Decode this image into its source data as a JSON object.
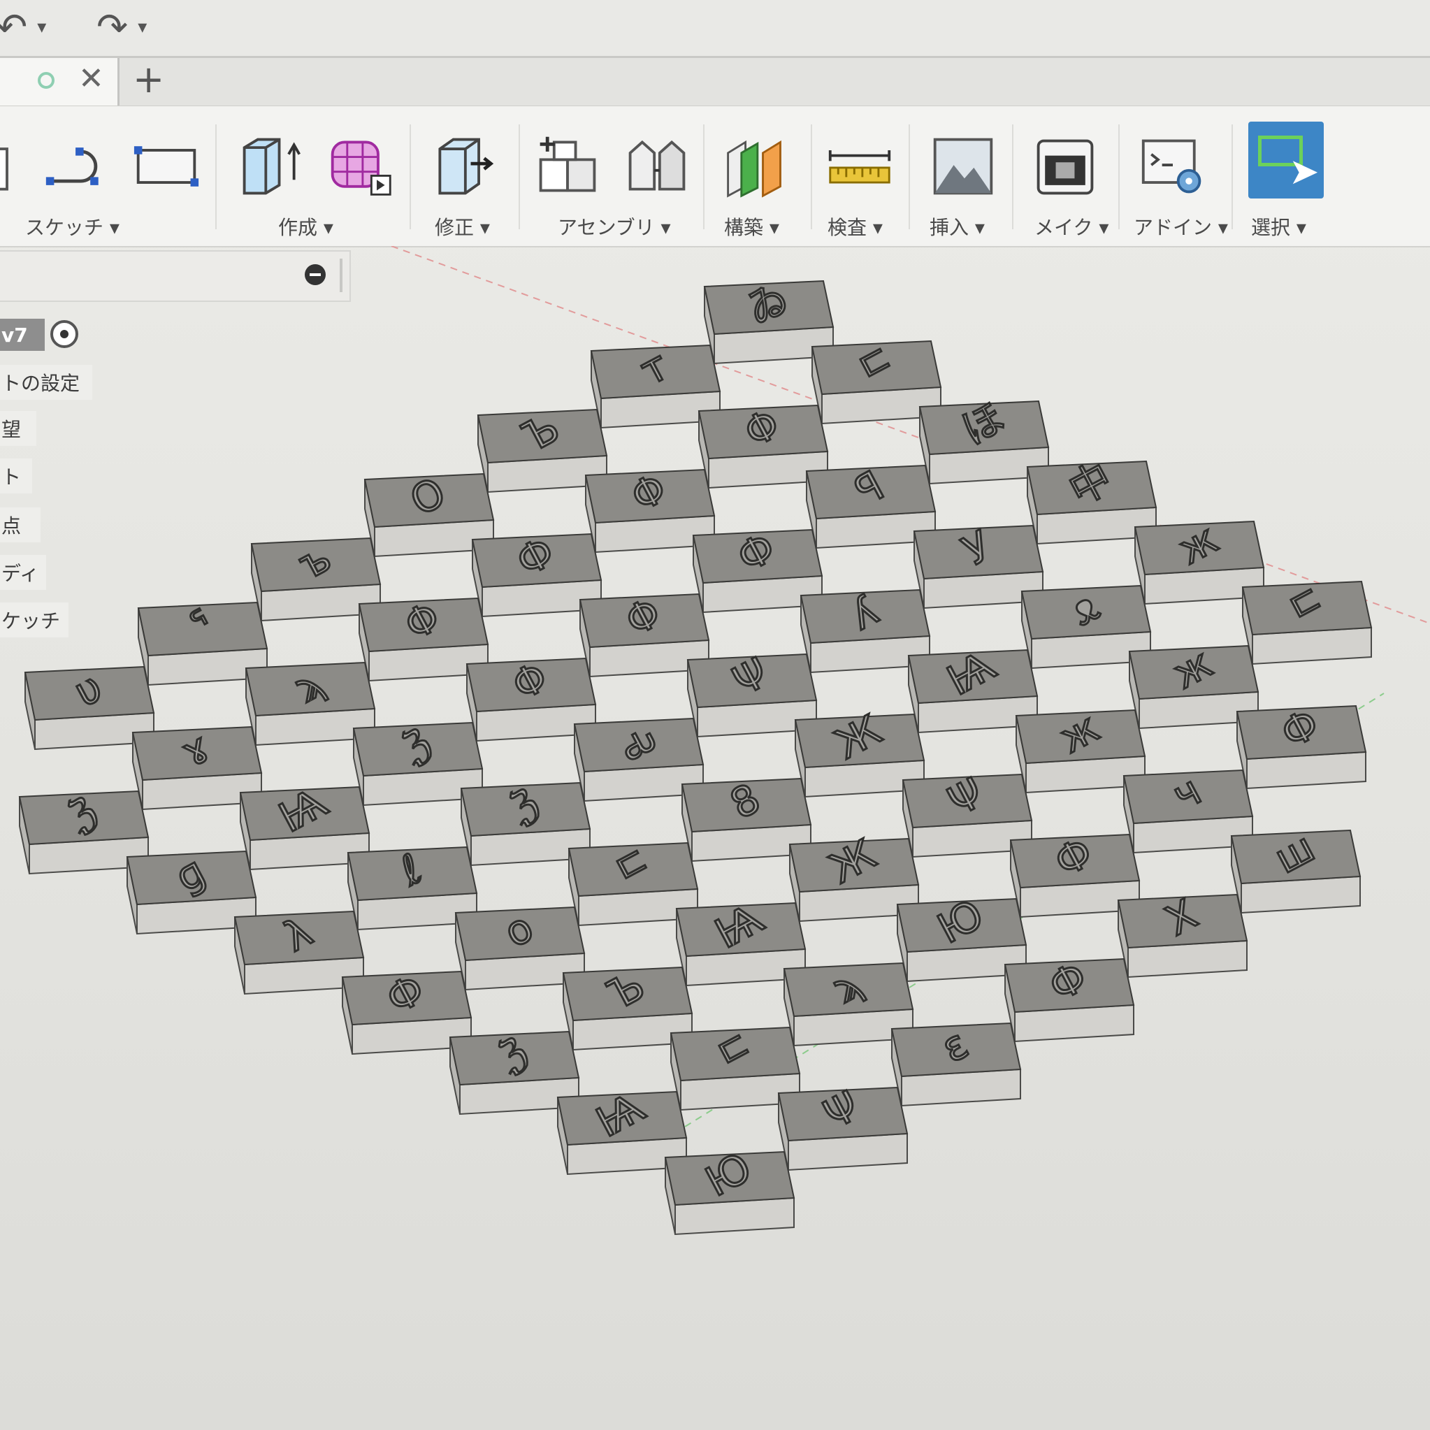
{
  "quick_access": {
    "undo_icon": "undo-arrow-icon",
    "redo_icon": "redo-arrow-icon",
    "dropdown_glyph": "▾"
  },
  "tabs": {
    "add_glyph": "+",
    "close_glyph": "✕"
  },
  "toolbar": {
    "groups": [
      {
        "label": "スケッチ ▾"
      },
      {
        "label": "作成 ▾"
      },
      {
        "label": "修正 ▾"
      },
      {
        "label": "アセンブリ ▾"
      },
      {
        "label": "構築 ▾"
      },
      {
        "label": "検査 ▾"
      },
      {
        "label": "挿入 ▾"
      },
      {
        "label": "メイク ▾"
      },
      {
        "label": "アドイン ▾"
      },
      {
        "label": "選択 ▾"
      }
    ],
    "accent_color": "#3d86c6"
  },
  "browser": {
    "doc_label": "v7",
    "items": [
      {
        "label": "トの設定"
      },
      {
        "label": "望"
      },
      {
        "label": "ト"
      },
      {
        "label": "点"
      },
      {
        "label": "ディ"
      },
      {
        "label": "ケッチ"
      }
    ]
  },
  "viewport": {
    "block_color": "#8c8b87",
    "glyphs": [
      "ゐ",
      "ㄷ",
      "ほ",
      "中",
      "ж",
      "ㄷ",
      "Φ",
      "Ф",
      "т",
      "Φ",
      "ꟼ",
      "У",
      "ᴥ",
      "ж",
      "Ф",
      "Φ",
      "Ъ",
      "Φ",
      "Ф",
      "ʎ",
      "Ѩ",
      "ж",
      "ч",
      "ш",
      "О",
      "Ф",
      "Φ",
      "Ψ",
      "Ж",
      "Ψ",
      "Ф",
      "X",
      "ъ",
      "Φ",
      "Φ",
      "ԃ",
      "8",
      "Ж",
      "Ю",
      "Ф",
      "ᕐ",
      "ϡ",
      "ℨ",
      "ℨ",
      "ㄷ",
      "Ѩ",
      "ϡ",
      "ɛ",
      "υ",
      "ɤ",
      "Ѩ",
      "ℓ",
      "o",
      "Ъ",
      "ㄷ",
      "Ψ",
      "Ч",
      "ℨ",
      "ɡ",
      "λ",
      "Ф",
      "ℨ",
      "Ѩ",
      "Ю"
    ]
  }
}
